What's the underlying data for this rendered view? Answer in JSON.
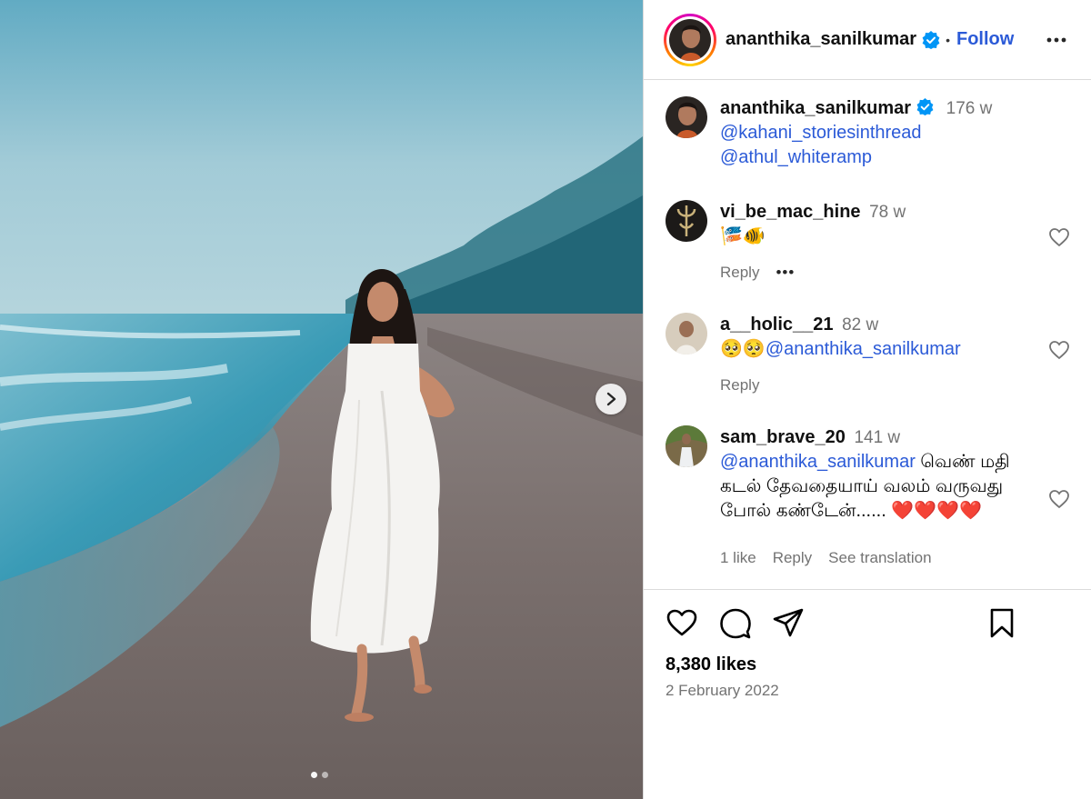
{
  "post": {
    "author": "ananthika_sanilkumar",
    "separator": "•",
    "follow_label": "Follow",
    "caption": {
      "username": "ananthika_sanilkumar",
      "time": "176 w",
      "mentions": [
        "@kahani_storiesinthread",
        "@athul_whiteramp"
      ]
    },
    "carousel": {
      "slide_count": 2,
      "current_slide": 1
    }
  },
  "comments": [
    {
      "username": "vi_be_mac_hine",
      "time": "78 w",
      "text": "🎏🐠",
      "likes": "",
      "reply_label": "Reply",
      "more_label": "•••"
    },
    {
      "username": "a__holic__21",
      "time": "82 w",
      "emoji": "🥺🥺",
      "mention": "@ananthika_sanilkumar",
      "reply_label": "Reply"
    },
    {
      "username": "sam_brave_20",
      "time": "141 w",
      "mention": "@ananthika_sanilkumar",
      "text": " வெண் மதி கடல் தேவதையாய் வலம் வருவது போல் கண்டேன்......",
      "hearts": "❤️❤️❤️❤️",
      "likes_label": "1 like",
      "reply_label": "Reply",
      "translation_label": "See translation"
    }
  ],
  "footer": {
    "likes": "8,380 likes",
    "date": "2 February 2022"
  },
  "colors": {
    "link": "#2b5ad7",
    "muted": "#737373",
    "border": "#dbdbdb",
    "verified": "#0095f6"
  }
}
